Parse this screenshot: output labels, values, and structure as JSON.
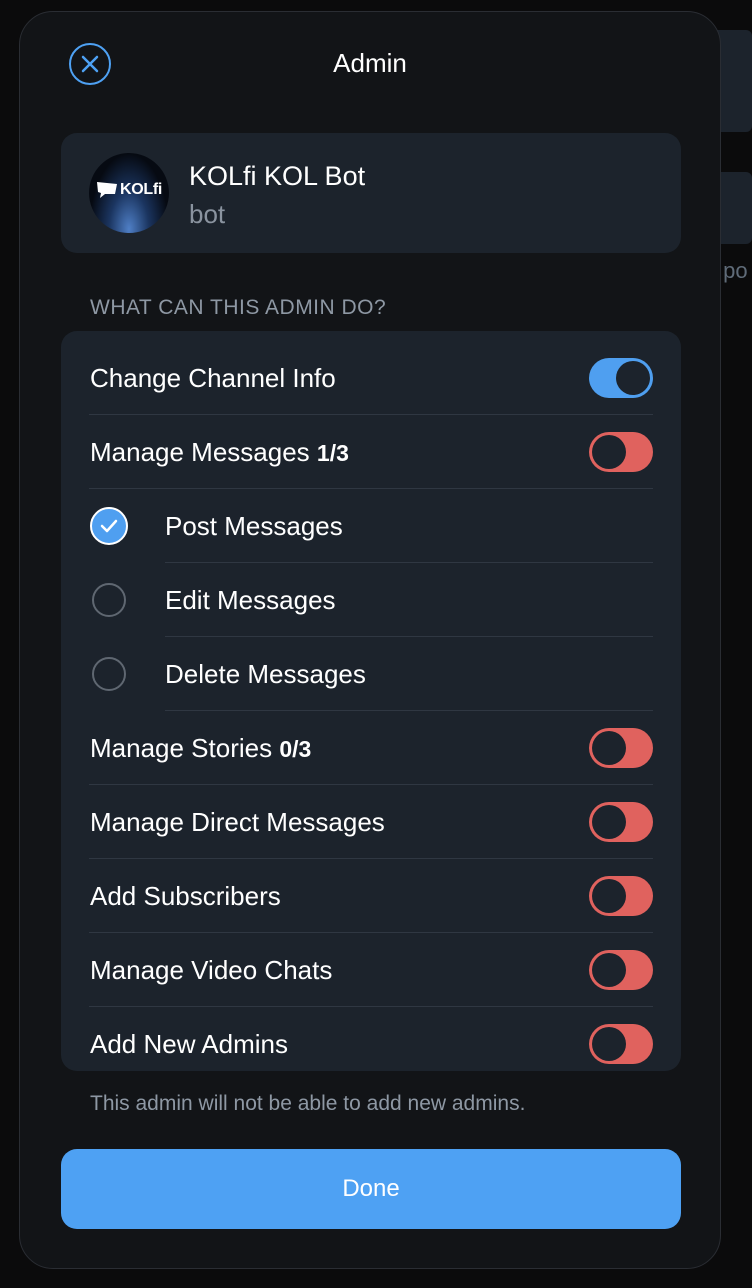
{
  "background": {
    "peek_text": "y po"
  },
  "header": {
    "title": "Admin",
    "close_icon": "close-circle-icon"
  },
  "profile": {
    "name": "KOLfi KOL Bot",
    "subtitle": "bot",
    "avatar_logo_text": "KOLfi"
  },
  "permissions": {
    "section_title": "WHAT CAN THIS ADMIN DO?",
    "items": [
      {
        "label": "Change Channel Info",
        "count": "",
        "type": "toggle",
        "enabled": true
      },
      {
        "label": "Manage Messages",
        "count": "1/3",
        "type": "toggle",
        "enabled": false
      },
      {
        "label": "Post Messages",
        "count": "",
        "type": "checkbox",
        "enabled": true
      },
      {
        "label": "Edit Messages",
        "count": "",
        "type": "checkbox",
        "enabled": false
      },
      {
        "label": "Delete Messages",
        "count": "",
        "type": "checkbox",
        "enabled": false
      },
      {
        "label": "Manage Stories",
        "count": "0/3",
        "type": "toggle",
        "enabled": false
      },
      {
        "label": "Manage Direct Messages",
        "count": "",
        "type": "toggle",
        "enabled": false
      },
      {
        "label": "Add Subscribers",
        "count": "",
        "type": "toggle",
        "enabled": false
      },
      {
        "label": "Manage Video Chats",
        "count": "",
        "type": "toggle",
        "enabled": false
      },
      {
        "label": "Add New Admins",
        "count": "",
        "type": "toggle",
        "enabled": false
      }
    ]
  },
  "footer_note": "This admin will not be able to add new admins.",
  "done_button": {
    "label": "Done"
  },
  "colors": {
    "accent": "#4ea1f3",
    "toggle_off": "#e0625e",
    "card_bg": "#1c232c",
    "modal_bg": "#121417"
  }
}
